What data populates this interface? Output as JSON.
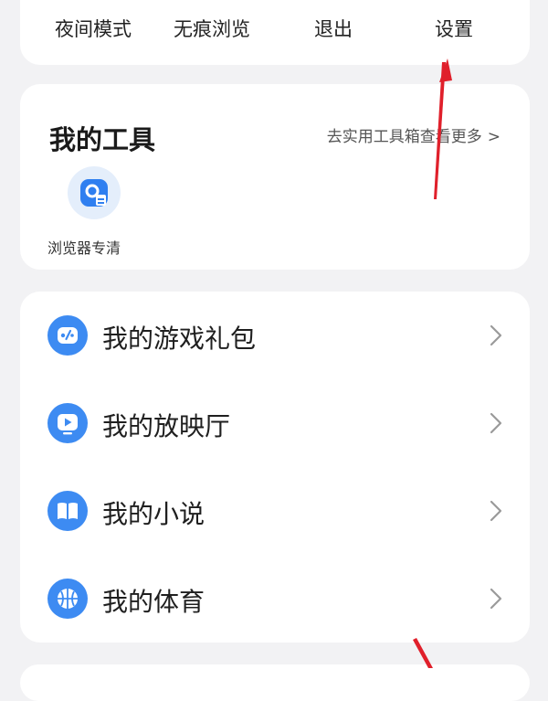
{
  "quick_menu": {
    "night_mode": "夜间模式",
    "incognito": "无痕浏览",
    "exit": "退出",
    "settings": "设置"
  },
  "tools": {
    "title": "我的工具",
    "more_link": "去实用工具箱查看更多",
    "more_chevron": ">",
    "items": [
      {
        "label": "浏览器专清",
        "icon": "browser-cleaner-icon"
      }
    ]
  },
  "list": {
    "items": [
      {
        "label": "我的游戏礼包",
        "icon": "game-controller-icon"
      },
      {
        "label": "我的放映厅",
        "icon": "play-screen-icon"
      },
      {
        "label": "我的小说",
        "icon": "open-book-icon"
      },
      {
        "label": "我的体育",
        "icon": "basketball-icon"
      }
    ]
  },
  "colors": {
    "accent": "#3d8bf2",
    "annotation_arrow": "#e0202b",
    "background": "#f2f2f4",
    "card": "#ffffff"
  }
}
